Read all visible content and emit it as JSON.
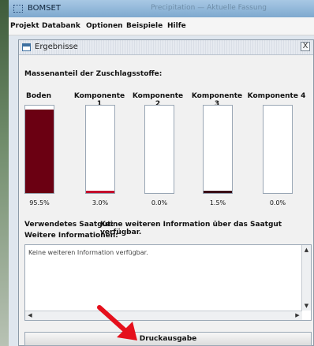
{
  "window": {
    "title": "BOMSET",
    "ghost_title": "Precipitation — Aktuelle Fassung"
  },
  "menu": [
    "Projekt",
    "Databank",
    "Optionen",
    "Beispiele",
    "Hilfe"
  ],
  "frame": {
    "title": "Ergebnisse",
    "close_label": "X"
  },
  "section": {
    "mass_fraction_label": "Massenanteil der Zuschlagsstoffe:",
    "seed_label": "Verwendetes Saatgut:",
    "seed_value": "Keine weiteren Information über das Saatgut verfügbar.",
    "info_label": "Weitere Informationen:"
  },
  "components": [
    {
      "name": "Boden",
      "value_label": "95.5%",
      "fraction": 0.955
    },
    {
      "name": "Komponente 1",
      "value_label": "3.0%",
      "fraction": 0.03
    },
    {
      "name": "Komponente 2",
      "value_label": "0.0%",
      "fraction": 0.0
    },
    {
      "name": "Komponente 3",
      "value_label": "1.5%",
      "fraction": 0.015
    },
    {
      "name": "Komponente 4",
      "value_label": "0.0%",
      "fraction": 0.0
    }
  ],
  "colors": {
    "boden_fill": "#6b0012",
    "komponente1_fill": "#c4102e",
    "komponente3_fill": "#3b1018"
  },
  "info_text": "Keine weiteren Information verfügbar.",
  "buttons": {
    "print_label": "Druckausgabe"
  }
}
